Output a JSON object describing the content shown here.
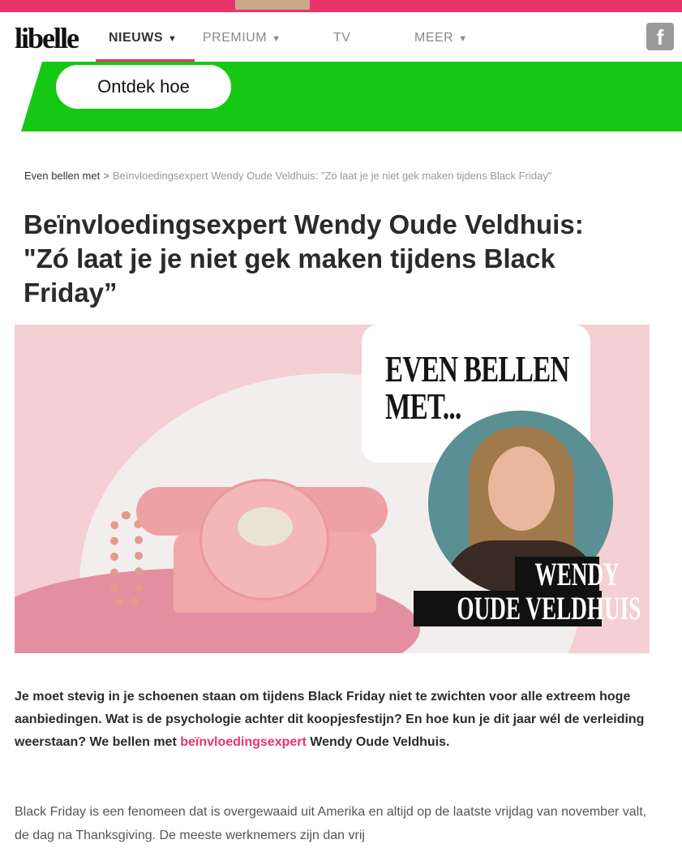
{
  "site": {
    "logo": "libelle"
  },
  "nav": {
    "items": [
      {
        "label": "NIEUWS",
        "has_dropdown": true,
        "active": true
      },
      {
        "label": "PREMIUM",
        "has_dropdown": true,
        "active": false
      },
      {
        "label": "TV",
        "has_dropdown": false,
        "active": false
      },
      {
        "label": "MEER",
        "has_dropdown": true,
        "active": false
      }
    ],
    "social_icon": "facebook-icon",
    "social_glyph": "f",
    "accent_color": "#e8336b"
  },
  "banner": {
    "cta_label": "Ontdek hoe",
    "background_color": "#14c814"
  },
  "breadcrumb": {
    "first": "Even bellen met",
    "separator": ">",
    "current": "Beïnvloedingsexpert Wendy Oude Veldhuis: \"Zó laat je je niet gek maken tijdens Black Friday\""
  },
  "article": {
    "title": "Beïnvloedingsexpert Wendy Oude Veldhuis: \"Zó laat je je niet gek maken tijdens Black Friday”",
    "hero": {
      "card_line1": "EVEN BELLEN",
      "card_line2": "MET...",
      "name_line1": "WENDY",
      "name_line2": "OUDE VELDHUIS"
    },
    "lead_part1": "Je moet stevig in je schoenen staan om tijdens Black Friday niet te zwichten voor alle extreem hoge aanbiedingen. Wat is de psychologie achter dit koopjesfestijn? En hoe kun je dit jaar wél de verleiding weerstaan? We bellen met ",
    "lead_link": "beïnvloedingsexpert",
    "lead_part2": " Wendy Oude Veldhuis.",
    "body": "Black Friday is een fenomeen dat is overgewaaid uit Amerika en altijd op de laatste vrijdag van november valt, de dag na Thanksgiving. De meeste werknemers zijn dan vrij"
  }
}
